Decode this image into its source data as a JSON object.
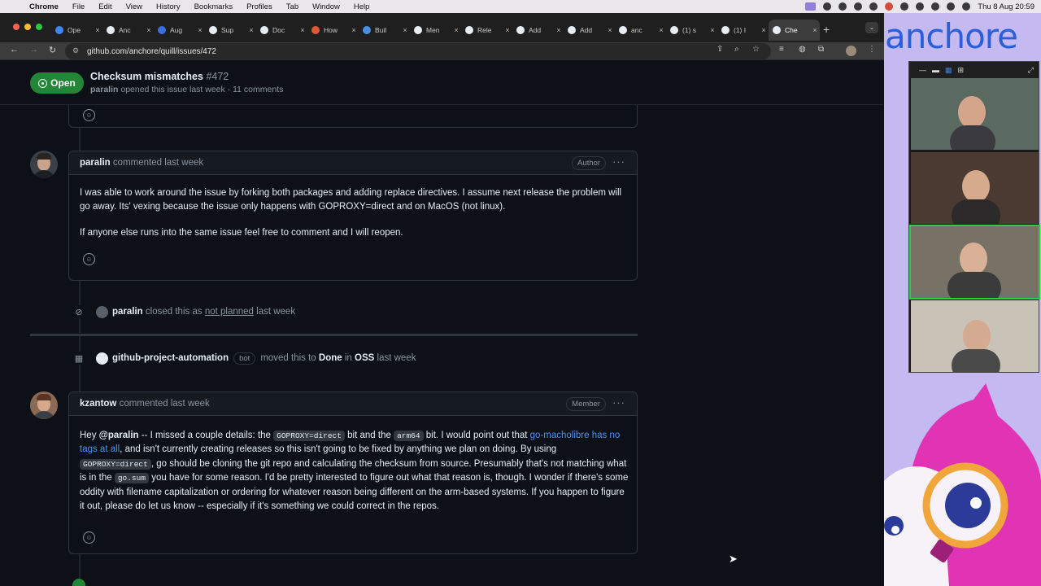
{
  "menubar": {
    "app": "Chrome",
    "items": [
      "File",
      "Edit",
      "View",
      "History",
      "Bookmarks",
      "Profiles",
      "Tab",
      "Window",
      "Help"
    ],
    "clock": "Thu 8 Aug 20:59"
  },
  "tabs": [
    {
      "title": "Ope",
      "fav_color": "#4285f4"
    },
    {
      "title": "Anc",
      "fav_color": "#e6edf3"
    },
    {
      "title": "Aug",
      "fav_color": "#3b6fe0"
    },
    {
      "title": "Sup",
      "fav_color": "#e6edf3"
    },
    {
      "title": "Doc",
      "fav_color": "#e6edf3"
    },
    {
      "title": "How",
      "fav_color": "#e05a3a"
    },
    {
      "title": "Buil",
      "fav_color": "#4a90e2"
    },
    {
      "title": "Men",
      "fav_color": "#e6edf3"
    },
    {
      "title": "Rele",
      "fav_color": "#e6edf3"
    },
    {
      "title": "Add",
      "fav_color": "#e6edf3"
    },
    {
      "title": "Add",
      "fav_color": "#e6edf3"
    },
    {
      "title": "anc",
      "fav_color": "#e6edf3"
    },
    {
      "title": "(1) s",
      "fav_color": "#e6edf3"
    },
    {
      "title": "(1) I",
      "fav_color": "#e6edf3"
    },
    {
      "title": "Che",
      "fav_color": "#e6edf3",
      "active": true
    }
  ],
  "toolbar": {
    "url": "github.com/anchore/quill/issues/472"
  },
  "issue": {
    "state": "Open",
    "title": "Checksum mismatches",
    "number": "#472",
    "author": "paralin",
    "meta_rest": "opened this issue last week · 11 comments"
  },
  "comments": [
    {
      "author": "paralin",
      "action": "commented last week",
      "role": "Author",
      "paragraphs": [
        "I was able to work around the issue by forking both packages and adding replace directives. I assume next release the problem will go away. Its' vexing because the issue only happens with GOPROXY=direct and on MacOS (not linux).",
        "If anyone else runs into the same issue feel free to comment and I will reopen."
      ]
    },
    {
      "author": "kzantow",
      "action": "commented last week",
      "role": "Member",
      "segments": {
        "s1": "Hey ",
        "mention": "@paralin",
        "s2": " -- I missed a couple details: the ",
        "code1": "GOPROXY=direct",
        "s3": " bit and the ",
        "code2": "arm64",
        "s4": " bit. I would point out that ",
        "link": "go-macholibre has no tags at all",
        "s5": ", and isn't currently creating releases so this isn't going to be fixed by anything we plan on doing. By using ",
        "code3": "GOPROXY=direct",
        "s6": ", go should be cloning the git repo and calculating the checksum from source. Presumably that's not matching what is in the ",
        "code4": "go.sum",
        "s7": " you have for some reason. I'd be pretty interested to figure out what that reason is, though. I wonder if there's some oddity with filename capitalization or ordering for whatever reason being different on the arm-based systems. If you happen to figure it out, please do let us know -- especially if it's something we could correct in the repos."
      }
    }
  ],
  "events": {
    "closed": {
      "actor": "paralin",
      "pre": "closed this as",
      "link": "not planned",
      "post": "last week"
    },
    "moved": {
      "actor": "github-project-automation",
      "badge": "bot",
      "pre": "moved this to",
      "column": "Done",
      "mid": "in",
      "project": "OSS",
      "post": "last week"
    }
  },
  "brand": {
    "name": "anchore"
  },
  "colors": {
    "accent_green": "#238636",
    "link_blue": "#4493f8",
    "brand_blue": "#2a5fd9",
    "brand_bg": "#c4b9f0"
  }
}
